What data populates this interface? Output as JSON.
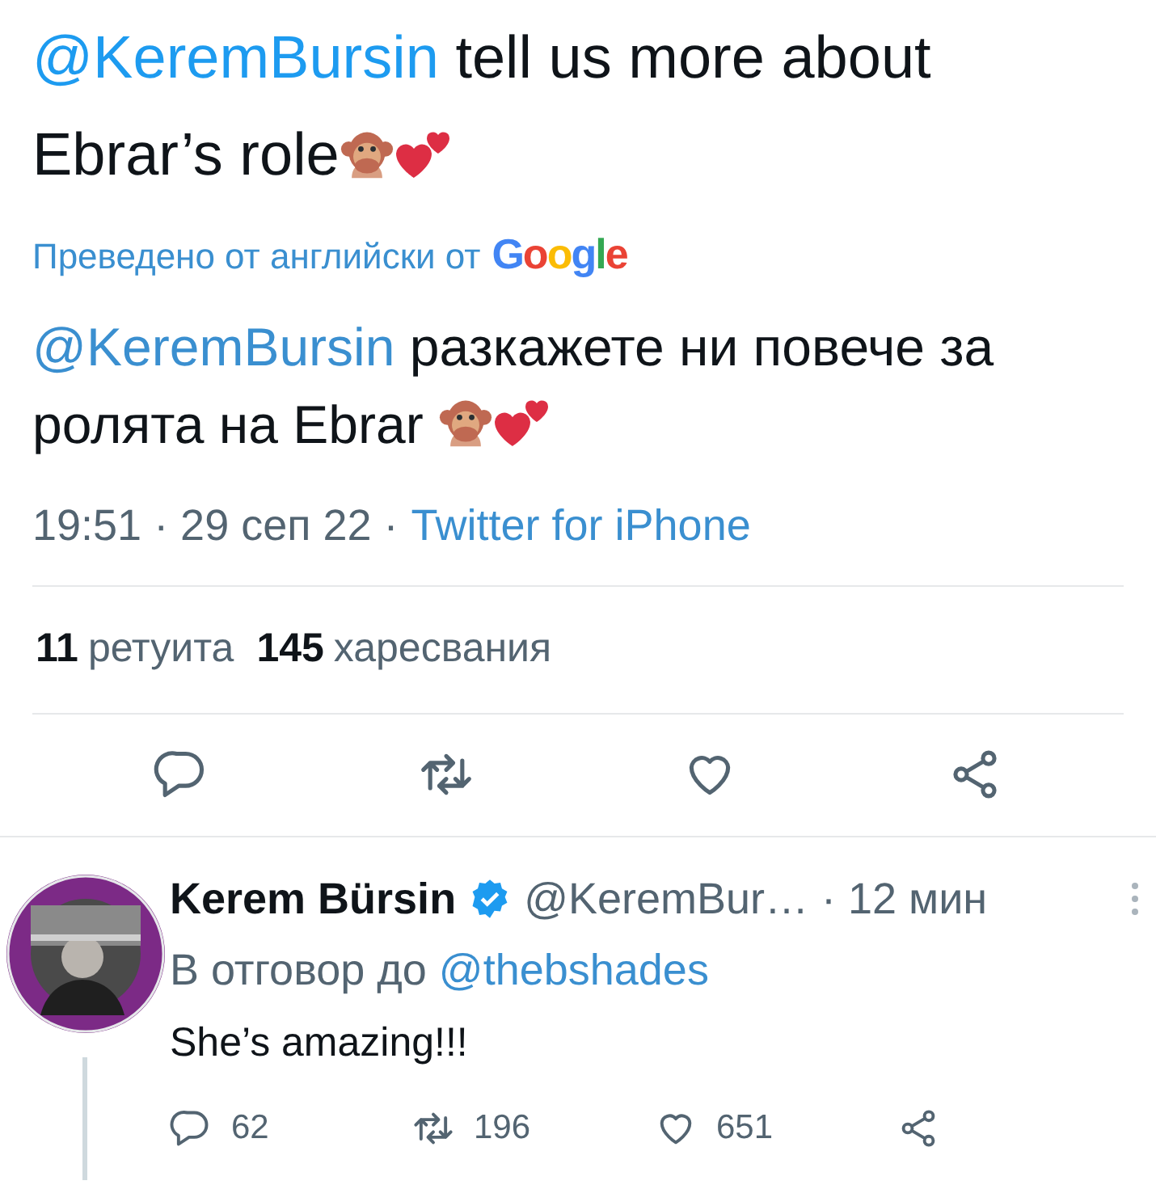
{
  "tweet": {
    "mention": "@KeremBursin",
    "text": "tell us more about Ebrar’s role",
    "translation": {
      "label": "Преведено от английски от",
      "provider": "Google",
      "mention": "@KeremBursin",
      "text": "разкажете ни повече за ролята на Ebrar"
    },
    "meta": "19:51 · 29 сеп 22 ·",
    "source": "Twitter for iPhone",
    "stats": [
      {
        "count": "11",
        "label": "ретуита"
      },
      {
        "count": "145",
        "label": "харесвания"
      }
    ],
    "actions": [
      {
        "kind": "reply"
      },
      {
        "kind": "retweet"
      },
      {
        "kind": "like"
      },
      {
        "kind": "share"
      }
    ]
  },
  "reply": {
    "name": "Kerem Bürsin",
    "verified": true,
    "handle": "@KeremBur…",
    "time": "· 12 мин",
    "reply_to_label": "В отговор до",
    "reply_to": "@thebshades",
    "text": "She’s amazing!!!",
    "actions": [
      {
        "kind": "reply",
        "count": "62"
      },
      {
        "kind": "retweet",
        "count": "196"
      },
      {
        "kind": "like",
        "count": "651"
      },
      {
        "kind": "share"
      }
    ]
  }
}
